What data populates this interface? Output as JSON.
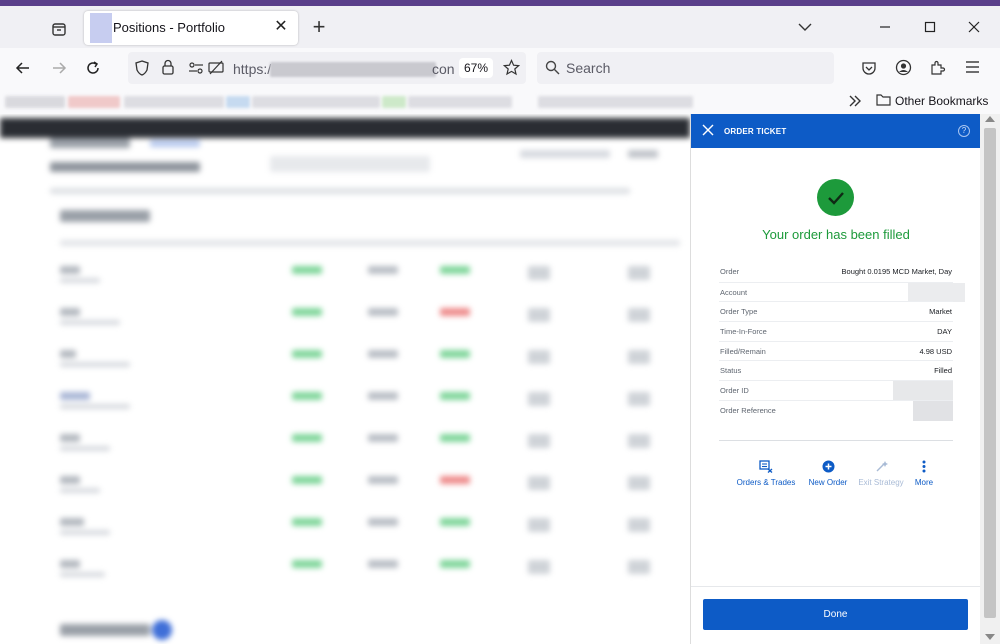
{
  "browser": {
    "tab_title": "Positions - Portfolio",
    "url_prefix": "https:/",
    "url_suffix": "con",
    "zoom": "67%",
    "search_placeholder": "Search",
    "other_bookmarks": "Other Bookmarks"
  },
  "order_ticket": {
    "title": "ORDER TICKET",
    "help": "?",
    "message": "Your order has been filled",
    "details": {
      "order_label": "Order",
      "order_value": "Bought 0.0195 MCD Market, Day",
      "account_label": "Account",
      "order_type_label": "Order Type",
      "order_type_value": "Market",
      "tif_label": "Time-In-Force",
      "tif_value": "DAY",
      "filled_label": "Filled/Remain",
      "filled_value": "4.98 USD",
      "status_label": "Status",
      "status_value": "Filled",
      "order_id_label": "Order ID",
      "order_ref_label": "Order Reference"
    },
    "actions": {
      "orders_trades": "Orders & Trades",
      "new_order": "New Order",
      "exit_strategy": "Exit Strategy",
      "more": "More"
    },
    "done": "Done"
  },
  "colors": {
    "accent": "#0d5bc6",
    "success": "#1d9a3b",
    "disabled": "#a9bbd6"
  },
  "icons": {
    "close": "close-icon",
    "check": "checkmark-icon",
    "orders": "orders-trades-icon",
    "new_order": "plus-circle-icon",
    "exit": "wand-icon",
    "more": "vertical-dots-icon"
  }
}
